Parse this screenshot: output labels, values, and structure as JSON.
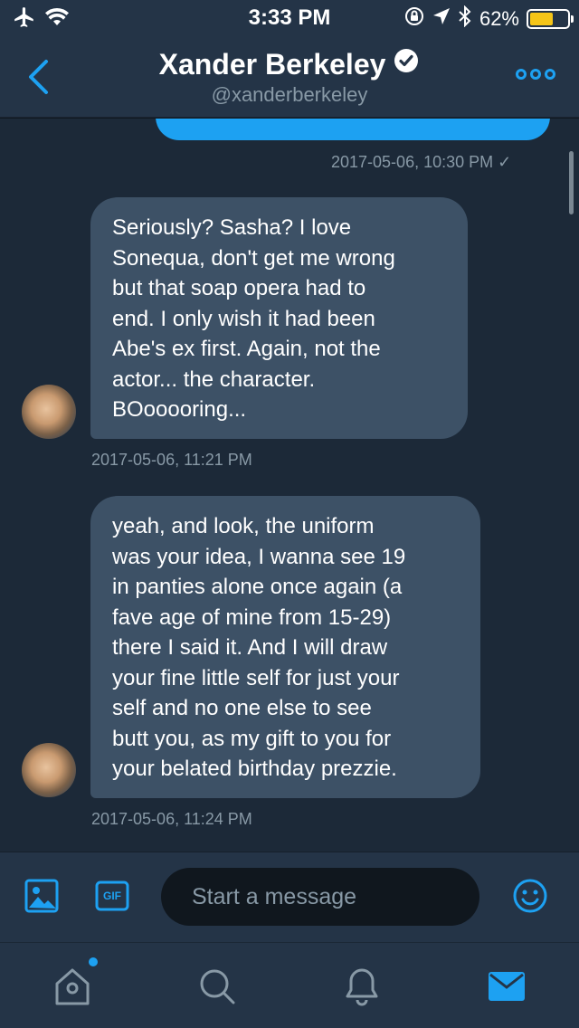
{
  "status_bar": {
    "time": "3:33 PM",
    "battery": "62%",
    "battery_level": 0.62,
    "icons": [
      "airplane-icon",
      "wifi-icon",
      "orientation-lock-icon",
      "location-icon",
      "bluetooth-icon",
      "battery-icon"
    ]
  },
  "header": {
    "name": "Xander Berkeley",
    "handle": "@xanderberkeley",
    "verified": true
  },
  "conversation": {
    "sent_timestamp": "2017-05-06, 10:30 PM ✓",
    "messages": [
      {
        "text": "Seriously? Sasha? I love\nSonequa, don't get me wrong\nbut that soap opera had to\nend. I only wish it had been\nAbe's ex first. Again, not the\nactor... the character.\nBOooooring...",
        "timestamp": "2017-05-06, 11:21 PM"
      },
      {
        "text": "yeah, and look, the uniform\nwas your idea, I wanna see 19\nin panties alone once again (a\nfave age of mine from 15-29)\nthere I said it. And I will draw\nyour fine little self for just your\nself and no one else to see\nbutt you, as my gift to you for\nyour belated birthday prezzie.",
        "timestamp": "2017-05-06, 11:24 PM"
      }
    ]
  },
  "composer": {
    "gif_label": "GIF",
    "placeholder": "Start a message"
  },
  "tabs": [
    "home-icon",
    "search-icon",
    "notifications-icon",
    "messages-icon"
  ],
  "colors": {
    "accent": "#1da1f2",
    "bar_bg": "#243447",
    "chat_bg": "#1c2938",
    "bubble_bg": "#3d5166",
    "muted": "#8899a6"
  }
}
